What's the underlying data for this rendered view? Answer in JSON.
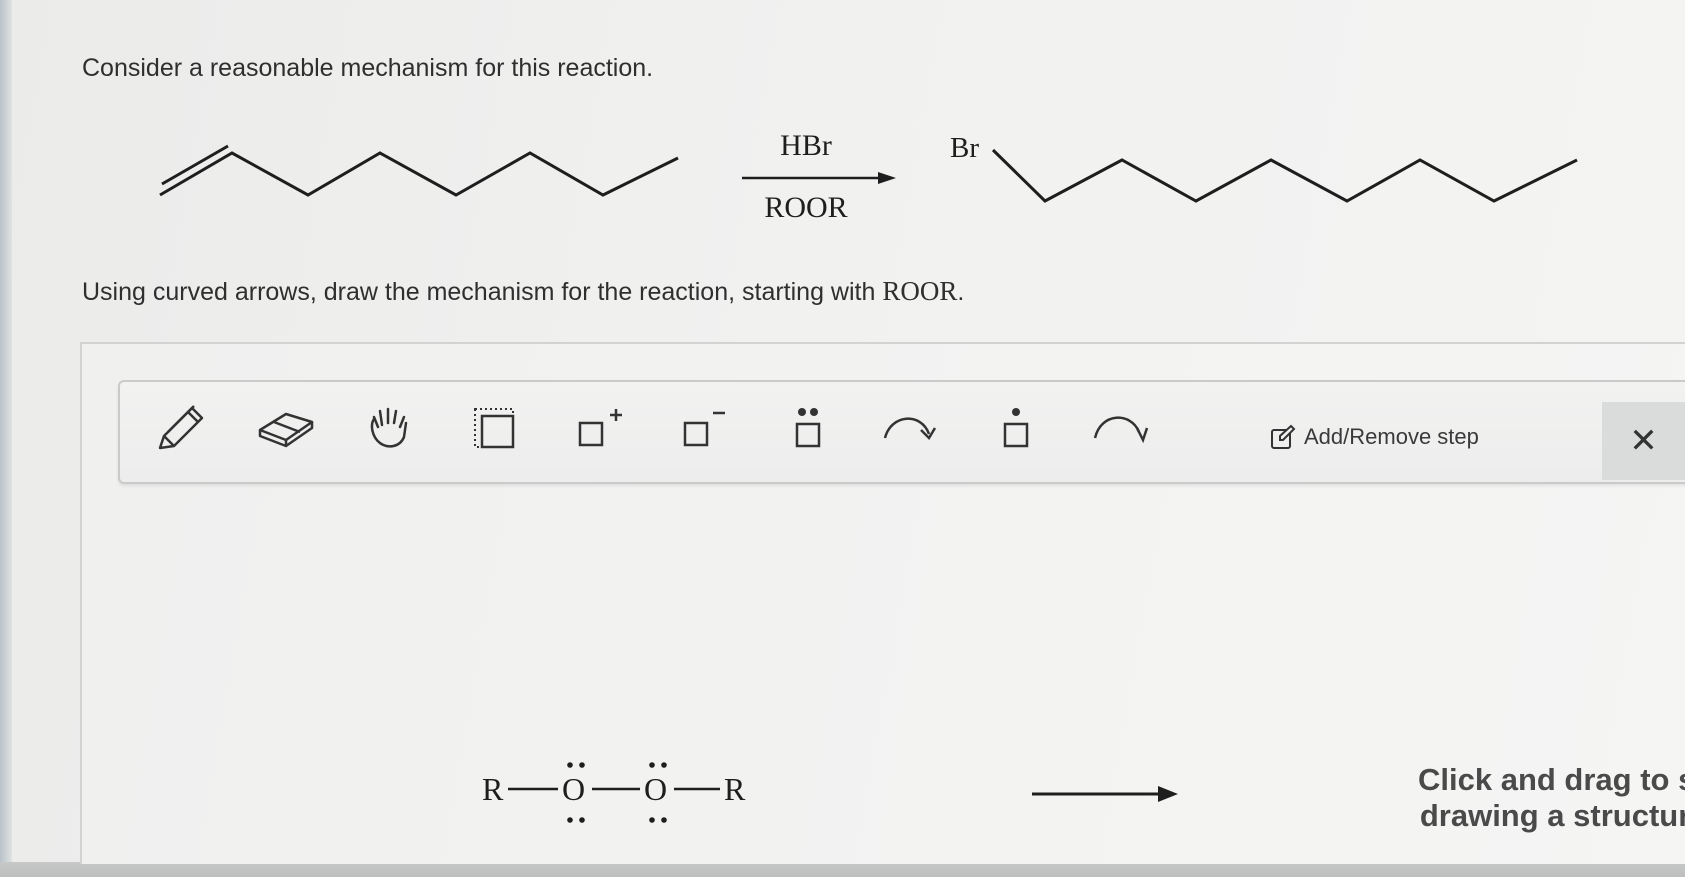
{
  "question": {
    "prompt": "Consider a reasonable mechanism for this reaction.",
    "instruction": "Using curved arrows, draw the mechanism for the reaction, starting with",
    "instruction_reagent": "ROOR",
    "instruction_end": "."
  },
  "reaction": {
    "reagent_above_arrow": "HBr",
    "reagent_below_arrow": "ROOR",
    "product_substituent": "Br"
  },
  "toolbar": {
    "tools": [
      "pencil-icon",
      "eraser-icon",
      "hand-icon",
      "select-box-icon",
      "positive-charge-icon",
      "negative-charge-icon",
      "lone-pair-icon",
      "curved-arrow-icon",
      "radical-icon",
      "single-electron-arrow-icon"
    ],
    "add_remove_label": "Add/Remove step",
    "close_label": "✕"
  },
  "canvas": {
    "left_r": "R",
    "oxygen_1": "O",
    "oxygen_2": "O",
    "right_r": "R",
    "hint_line1": "Click and drag to start",
    "hint_line2": "drawing a structure."
  }
}
